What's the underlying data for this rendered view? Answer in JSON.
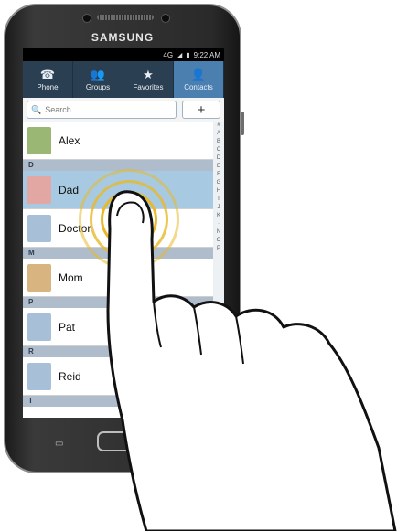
{
  "device": {
    "brand": "SAMSUNG"
  },
  "status_bar": {
    "network": "4G",
    "time": "9:22 AM"
  },
  "tabs": [
    {
      "label": "Phone",
      "icon": "phone-icon"
    },
    {
      "label": "Groups",
      "icon": "groups-icon"
    },
    {
      "label": "Favorites",
      "icon": "star-icon"
    },
    {
      "label": "Contacts",
      "icon": "contact-icon",
      "active": true
    }
  ],
  "search": {
    "placeholder": "Search",
    "add_label": "+"
  },
  "contacts": {
    "first": {
      "name": "Alex"
    },
    "header_d": "D",
    "dad": {
      "name": "Dad"
    },
    "doctor": {
      "name": "Doctor"
    },
    "header_m": "M",
    "mom": {
      "name": "Mom"
    },
    "header_p": "P",
    "pat": {
      "name": "Pat"
    },
    "header_r": "R",
    "reid": {
      "name": "Reid"
    },
    "header_t": "T"
  },
  "index_letters": [
    "#",
    "A",
    "B",
    "C",
    "D",
    "E",
    "F",
    "G",
    "H",
    "I",
    "J",
    "K",
    "·",
    "N",
    "O",
    "P"
  ],
  "colors": {
    "tab_bar": "#2b3f52",
    "active_tab": "#4a7fb0",
    "selected_row": "#a7c9e2",
    "section_header": "#aebccb",
    "tap_ripple": "#e8b92b"
  }
}
